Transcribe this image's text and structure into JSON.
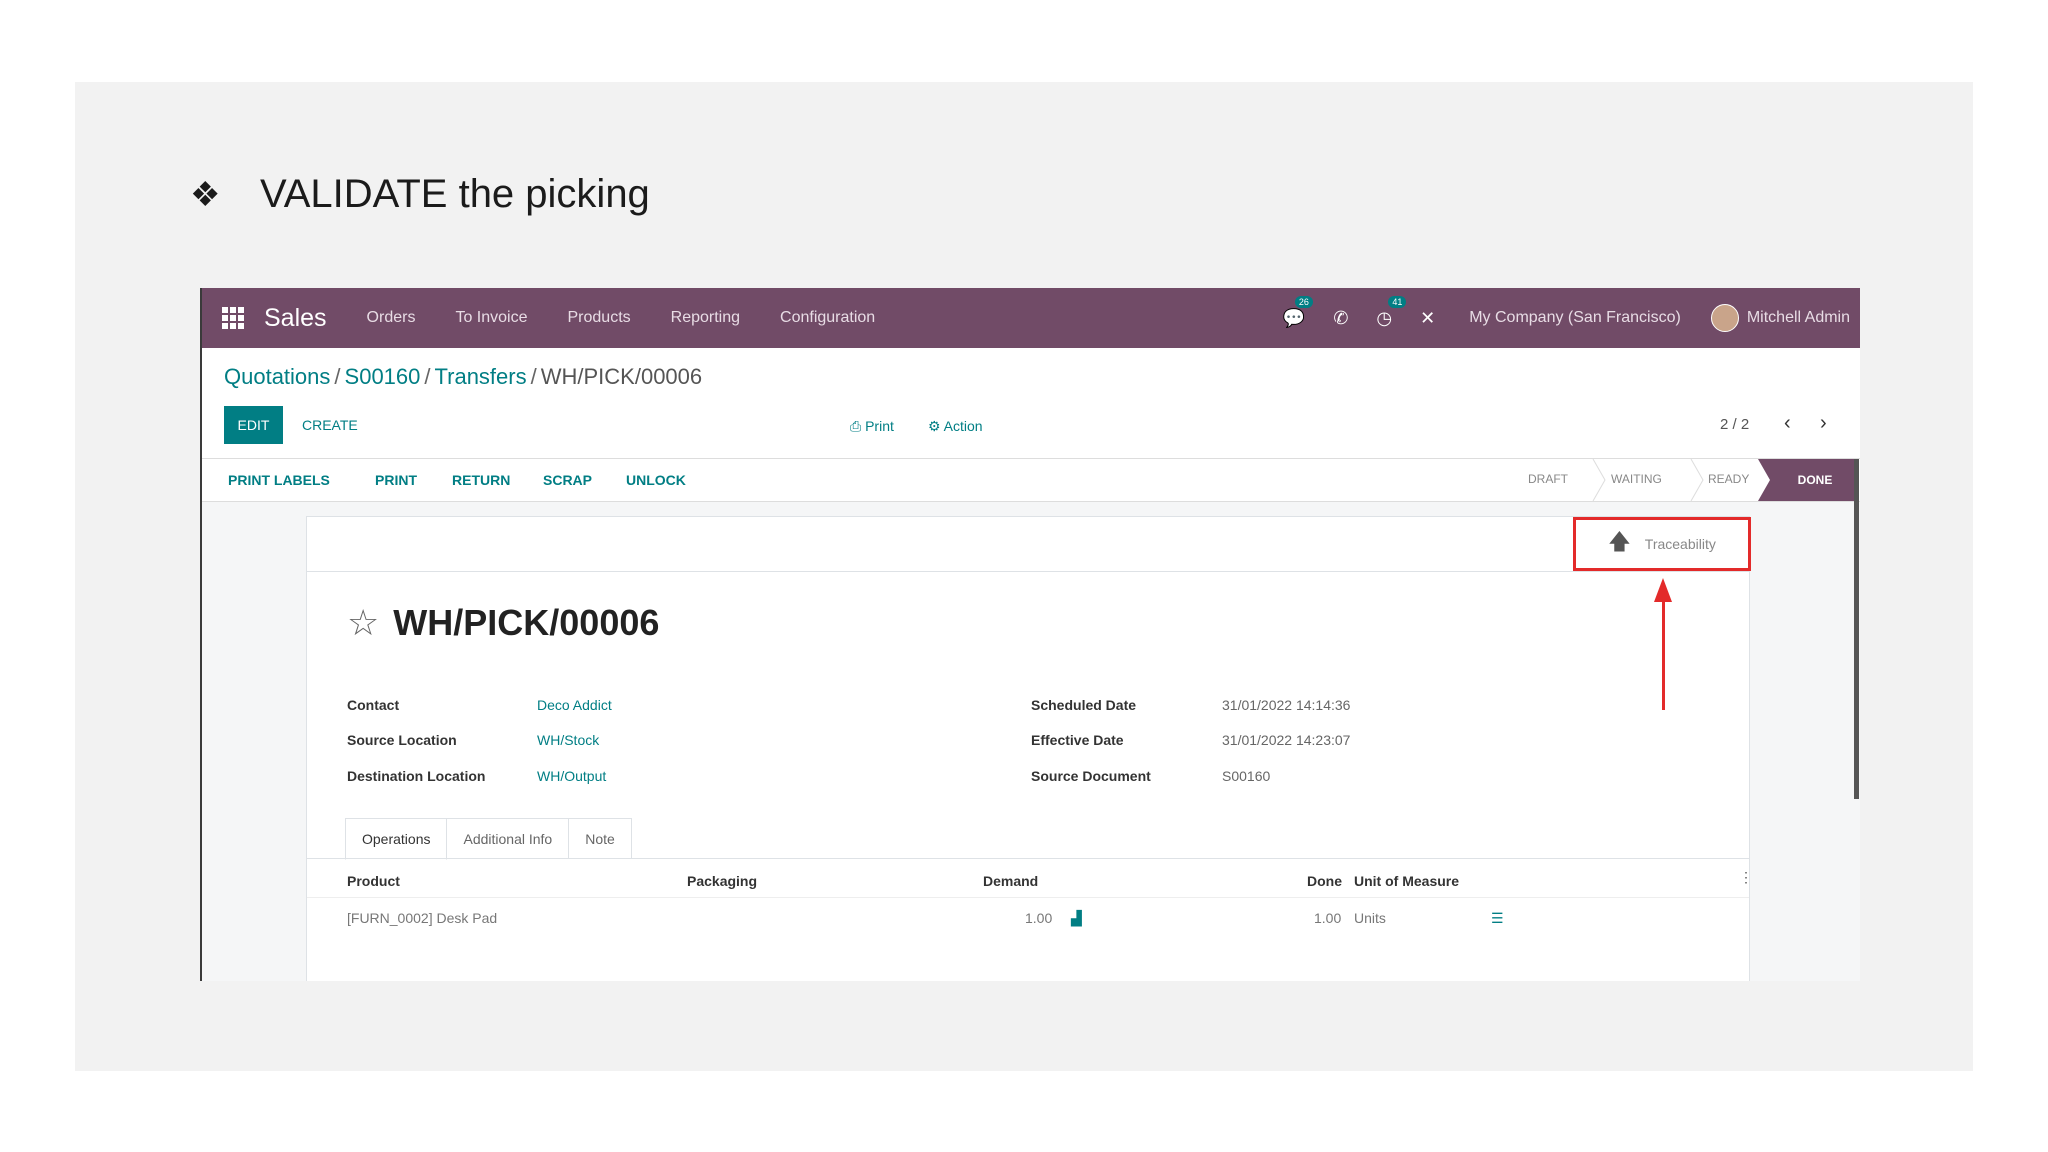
{
  "slide": {
    "bullet": "❖",
    "title": "VALIDATE the picking"
  },
  "navbar": {
    "app_name": "Sales",
    "menus": [
      "Orders",
      "To Invoice",
      "Products",
      "Reporting",
      "Configuration"
    ],
    "chat_badge": "26",
    "activity_badge": "41",
    "company": "My Company (San Francisco)",
    "user": "Mitchell Admin"
  },
  "breadcrumb": {
    "items": [
      "Quotations",
      "S00160",
      "Transfers"
    ],
    "current": "WH/PICK/00006"
  },
  "control": {
    "edit": "EDIT",
    "create": "CREATE",
    "print": "Print",
    "action": "Action",
    "pager": "2 / 2"
  },
  "statusbar": {
    "buttons": [
      "PRINT LABELS",
      "PRINT",
      "RETURN",
      "SCRAP",
      "UNLOCK"
    ],
    "stages": [
      "DRAFT",
      "WAITING",
      "READY",
      "DONE"
    ]
  },
  "form": {
    "traceability": "Traceability",
    "title": "WH/PICK/00006",
    "contact_label": "Contact",
    "contact": "Deco Addict",
    "source_label": "Source Location",
    "source": "WH/Stock",
    "dest_label": "Destination Location",
    "dest": "WH/Output",
    "scheduled_label": "Scheduled Date",
    "scheduled": "31/01/2022 14:14:36",
    "effective_label": "Effective Date",
    "effective": "31/01/2022 14:23:07",
    "srcdoc_label": "Source Document",
    "srcdoc": "S00160",
    "tabs": [
      "Operations",
      "Additional Info",
      "Note"
    ],
    "columns": [
      "Product",
      "Packaging",
      "Demand",
      "Done",
      "Unit of Measure"
    ],
    "row": {
      "product": "[FURN_0002] Desk Pad",
      "demand": "1.00",
      "done": "1.00",
      "uom": "Units"
    }
  },
  "colors": {
    "brand": "#714b67",
    "accent": "#017e84",
    "highlight": "#e32a2a"
  }
}
